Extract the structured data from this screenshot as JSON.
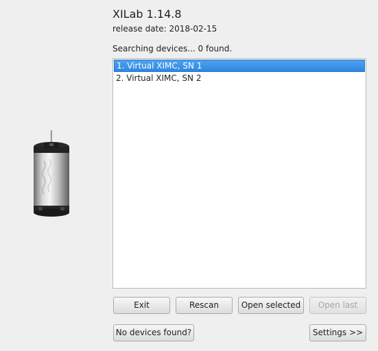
{
  "header": {
    "title": "XILab 1.14.8",
    "release_date": "release date: 2018-02-15"
  },
  "status": "Searching devices... 0 found.",
  "devices": [
    {
      "label": "1. Virtual XIMC, SN 1",
      "selected": true
    },
    {
      "label": "2. Virtual XIMC, SN 2",
      "selected": false
    }
  ],
  "buttons": {
    "exit": "Exit",
    "rescan": "Rescan",
    "open_selected": "Open selected",
    "open_last": "Open last",
    "no_devices": "No devices found?",
    "settings": "Settings >>"
  },
  "colors": {
    "selection": "#3a8ee6",
    "background": "#efefef"
  },
  "icons": {
    "motor_image": "stepper-motor-icon"
  }
}
